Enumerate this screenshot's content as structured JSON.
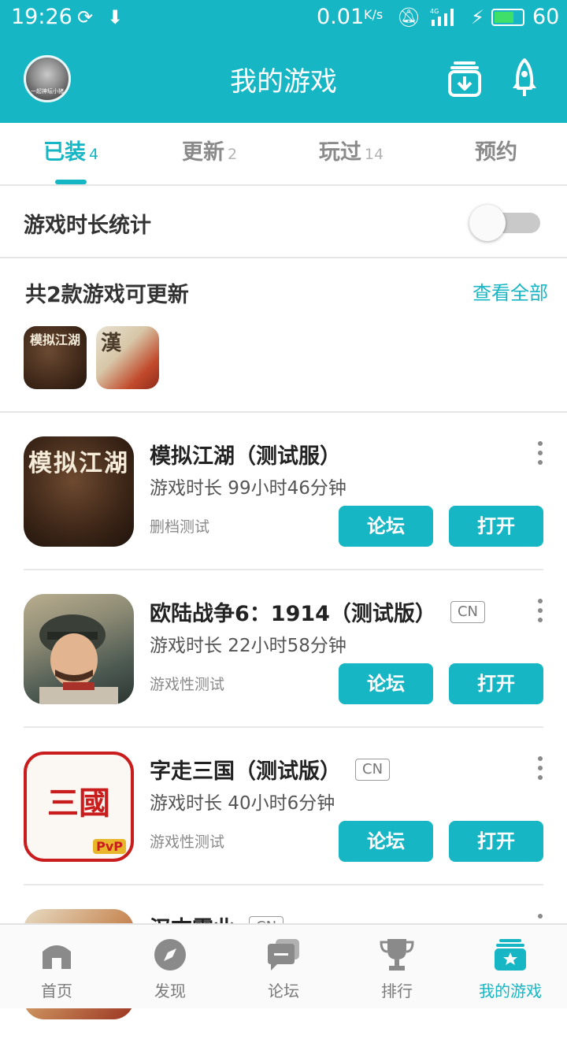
{
  "status_bar": {
    "time": "19:26",
    "speed": "0.01",
    "speed_unit": "K/s",
    "network": "4G",
    "battery": "60"
  },
  "header": {
    "title": "我的游戏",
    "avatar_caption": "一起神坛小猪",
    "icons": [
      "download-manager-icon",
      "rocket-icon"
    ]
  },
  "tabs": [
    {
      "label": "已装",
      "count": "4",
      "active": true
    },
    {
      "label": "更新",
      "count": "2",
      "active": false
    },
    {
      "label": "玩过",
      "count": "14",
      "active": false
    },
    {
      "label": "预约",
      "count": "",
      "active": false
    }
  ],
  "stats": {
    "label": "游戏时长统计",
    "enabled": false
  },
  "updates": {
    "title": "共2款游戏可更新",
    "view_all": "查看全部",
    "icon_glyphs": [
      "模拟江湖",
      "漢"
    ]
  },
  "games": [
    {
      "name": "模拟江湖（测试服）",
      "tag": "",
      "playtime": "游戏时长 99小时46分钟",
      "note": "删档测试",
      "icon_glyph": "模拟江湖",
      "forum_label": "论坛",
      "open_label": "打开"
    },
    {
      "name": "欧陆战争6：1914（测试版）",
      "tag": "CN",
      "playtime": "游戏时长 22小时58分钟",
      "note": "游戏性测试",
      "icon_glyph": "",
      "forum_label": "论坛",
      "open_label": "打开"
    },
    {
      "name": "字走三国（测试版）",
      "tag": "CN",
      "playtime": "游戏时长 40小时6分钟",
      "note": "游戏性测试",
      "icon_glyph": "三國",
      "forum_label": "论坛",
      "open_label": "打开"
    },
    {
      "name": "汉末霸业",
      "tag": "CN",
      "playtime": "",
      "note": "",
      "icon_glyph": "",
      "forum_label": "",
      "open_label": ""
    }
  ],
  "bottom_nav": [
    {
      "label": "首页",
      "icon": "home-icon",
      "active": false
    },
    {
      "label": "发现",
      "icon": "compass-icon",
      "active": false
    },
    {
      "label": "论坛",
      "icon": "forum-icon",
      "active": false
    },
    {
      "label": "排行",
      "icon": "trophy-icon",
      "active": false
    },
    {
      "label": "我的游戏",
      "icon": "my-games-icon",
      "active": true
    }
  ],
  "colors": {
    "accent": "#17b6c5",
    "tag_border": "#9a9a9a",
    "toggle_off": "#c9c9c9"
  }
}
